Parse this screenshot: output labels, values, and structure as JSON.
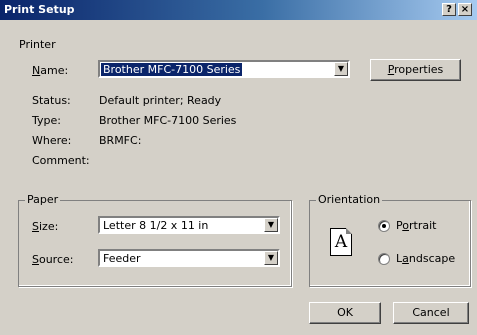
{
  "title": "Print Setup",
  "title_buttons": {
    "help": "?",
    "close": "×"
  },
  "printer": {
    "group_title": "Printer",
    "name_label": "Name:",
    "name_label_accel": "N",
    "name_label_rest": "ame:",
    "name_value": "Brother MFC-7100 Series",
    "properties_button": "Properties",
    "properties_accel": "P",
    "properties_rest": "roperties",
    "status_label": "Status:",
    "status_value": "Default printer; Ready",
    "type_label": "Type:",
    "type_value": "Brother MFC-7100 Series",
    "where_label": "Where:",
    "where_value": "BRMFC:",
    "comment_label": "Comment:",
    "comment_value": ""
  },
  "paper": {
    "group_title": "Paper",
    "size_label_accel": "S",
    "size_label_rest": "ize:",
    "size_value": "Letter 8 1/2 x 11 in",
    "source_label_accel": "S",
    "source_label_rest": "ource:",
    "source_value": "Feeder"
  },
  "orientation": {
    "group_title": "Orientation",
    "icon_letter": "A",
    "portrait_accel": "o",
    "portrait_pre": "P",
    "portrait_post": "rtrait",
    "portrait_checked": true,
    "landscape_pre": "L",
    "landscape_accel": "a",
    "landscape_post": "ndscape",
    "landscape_checked": false
  },
  "buttons": {
    "ok": "OK",
    "cancel": "Cancel"
  },
  "colors": {
    "title_start": "#0a246a",
    "title_end": "#a6caf0",
    "face": "#d4d0c8",
    "selection": "#0a246a"
  },
  "icons": [
    "help-icon",
    "close-icon",
    "dropdown-arrow-icon",
    "portrait-page-icon"
  ]
}
